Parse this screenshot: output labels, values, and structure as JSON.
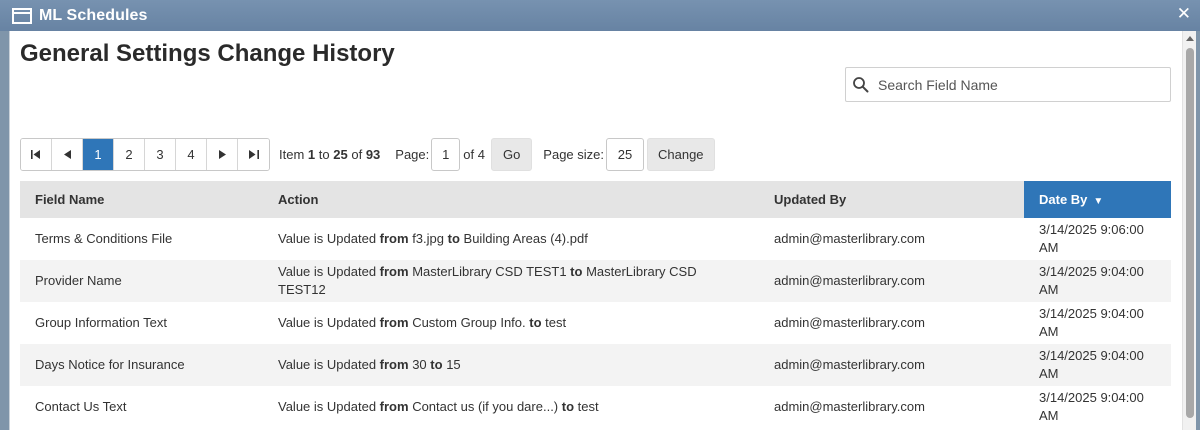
{
  "window": {
    "title": "ML Schedules",
    "close_glyph": "✕"
  },
  "page_title": "General Settings Change History",
  "search": {
    "placeholder": "Search Field Name",
    "value": ""
  },
  "pager": {
    "first": "⏮",
    "prev": "◀",
    "next": "▶",
    "last": "⏭",
    "pages": [
      "1",
      "2",
      "3",
      "4"
    ],
    "active_page": "1",
    "item_prefix": "Item",
    "item_from": "1",
    "item_to_word": "to",
    "item_to": "25",
    "item_of_word": "of",
    "item_total": "93",
    "page_label": "Page:",
    "page_value": "1",
    "page_of": "of 4",
    "go_label": "Go",
    "page_size_label": "Page size:",
    "page_size_value": "25",
    "change_label": "Change"
  },
  "table": {
    "columns": [
      "Field Name",
      "Action",
      "Updated By",
      "Date By"
    ],
    "sort_indicator": "▼",
    "rows": [
      {
        "field": "Terms & Conditions File",
        "action_prefix": "Value is Updated",
        "from_word": "from",
        "old": "f3.jpg",
        "to_word": "to",
        "new": "Building Areas (4).pdf",
        "updated_by": "admin@masterlibrary.com",
        "date_line1": "3/14/2025 9:06:00",
        "date_line2": "AM"
      },
      {
        "field": "Provider Name",
        "action_prefix": "Value is Updated",
        "from_word": "from",
        "old": "MasterLibrary CSD TEST1",
        "to_word": "to",
        "new": "MasterLibrary CSD TEST12",
        "updated_by": "admin@masterlibrary.com",
        "date_line1": "3/14/2025 9:04:00",
        "date_line2": "AM"
      },
      {
        "field": "Group Information Text",
        "action_prefix": "Value is Updated",
        "from_word": "from",
        "old": "Custom Group Info.",
        "to_word": "to",
        "new": "test",
        "updated_by": "admin@masterlibrary.com",
        "date_line1": "3/14/2025 9:04:00",
        "date_line2": "AM"
      },
      {
        "field": "Days Notice for Insurance",
        "action_prefix": "Value is Updated",
        "from_word": "from",
        "old": "30",
        "to_word": "to",
        "new": "15",
        "updated_by": "admin@masterlibrary.com",
        "date_line1": "3/14/2025 9:04:00",
        "date_line2": "AM"
      },
      {
        "field": "Contact Us Text",
        "action_prefix": "Value is Updated",
        "from_word": "from",
        "old": "Contact us (if you dare...)",
        "to_word": "to",
        "new": "test",
        "updated_by": "admin@masterlibrary.com",
        "date_line1": "3/14/2025 9:04:00",
        "date_line2": "AM"
      }
    ]
  },
  "colors": {
    "accent": "#2f76b8",
    "titlebar": "#6f8bab",
    "header_bg": "#e4e4e4",
    "alt_row": "#f3f3f3"
  }
}
